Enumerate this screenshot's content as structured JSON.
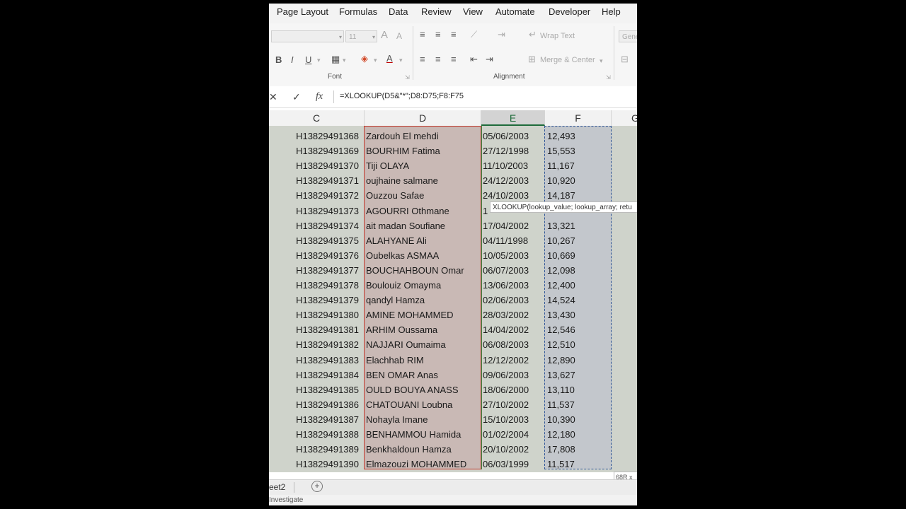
{
  "menu": {
    "tabs": [
      "Page Layout",
      "Formulas",
      "Data",
      "Review",
      "View",
      "Automate",
      "Developer",
      "Help"
    ]
  },
  "ribbon": {
    "font": {
      "font_size": "11",
      "bold": "B",
      "italic": "I",
      "underline": "U",
      "increase_font": "A",
      "decrease_font": "A",
      "group_label": "Font"
    },
    "alignment": {
      "wrap_text": "Wrap Text",
      "merge_center": "Merge & Center",
      "group_label": "Alignment"
    },
    "number": {
      "format_partial": "Gene"
    }
  },
  "formula_bar": {
    "cancel": "✕",
    "enter": "✓",
    "fx": "fx",
    "formula": "=XLOOKUP(D5&\"*\";D8:D75;F8:F75"
  },
  "columns": [
    {
      "label": "C",
      "selected": false
    },
    {
      "label": "D",
      "selected": false
    },
    {
      "label": "E",
      "selected": true
    },
    {
      "label": "F",
      "selected": false
    },
    {
      "label": "G",
      "selected": false
    }
  ],
  "rows": [
    {
      "id": "H13829491368",
      "name": "Zardouh  El mehdi",
      "date": "05/06/2003",
      "amount": "12,493"
    },
    {
      "id": "H13829491369",
      "name": "BOURHIM Fatima",
      "date": "27/12/1998",
      "amount": "15,553"
    },
    {
      "id": "H13829491370",
      "name": "Tiji OLAYA",
      "date": "11/10/2003",
      "amount": "11,167"
    },
    {
      "id": "H13829491371",
      "name": "oujhaine salmane",
      "date": "24/12/2003",
      "amount": "10,920"
    },
    {
      "id": "H13829491372",
      "name": "Ouzzou  Safae",
      "date": "24/10/2003",
      "amount": "14,187"
    },
    {
      "id": "H13829491373",
      "name": "AGOURRI Othmane",
      "date": "1",
      "amount": ""
    },
    {
      "id": "H13829491374",
      "name": "ait madan Soufiane",
      "date": "17/04/2002",
      "amount": "13,321"
    },
    {
      "id": "H13829491375",
      "name": "ALAHYANE Ali",
      "date": "04/11/1998",
      "amount": "10,267"
    },
    {
      "id": "H13829491376",
      "name": "Oubelkas ASMAA",
      "date": "10/05/2003",
      "amount": "10,669"
    },
    {
      "id": "H13829491377",
      "name": "BOUCHAHBOUN Omar",
      "date": "06/07/2003",
      "amount": "12,098"
    },
    {
      "id": "H13829491378",
      "name": "Boulouiz Omayma",
      "date": "13/06/2003",
      "amount": "12,400"
    },
    {
      "id": "H13829491379",
      "name": "qandyl Hamza",
      "date": "02/06/2003",
      "amount": "14,524"
    },
    {
      "id": "H13829491380",
      "name": "AMINE MOHAMMED",
      "date": "28/03/2002",
      "amount": "13,430"
    },
    {
      "id": "H13829491381",
      "name": "ARHIM Oussama",
      "date": "14/04/2002",
      "amount": "12,546"
    },
    {
      "id": "H13829491382",
      "name": "NAJJARI Oumaima",
      "date": "06/08/2003",
      "amount": "12,510"
    },
    {
      "id": "H13829491383",
      "name": "Elachhab RIM",
      "date": "12/12/2002",
      "amount": "12,890"
    },
    {
      "id": "H13829491384",
      "name": "BEN OMAR Anas",
      "date": "09/06/2003",
      "amount": "13,627"
    },
    {
      "id": "H13829491385",
      "name": "OULD BOUYA ANASS",
      "date": "18/06/2000",
      "amount": "13,110"
    },
    {
      "id": "H13829491386",
      "name": "CHATOUANI Loubna",
      "date": "27/10/2002",
      "amount": "11,537"
    },
    {
      "id": "H13829491387",
      "name": "Nohayla Imane",
      "date": "15/10/2003",
      "amount": "10,390"
    },
    {
      "id": "H13829491388",
      "name": "BENHAMMOU Hamida",
      "date": "01/02/2004",
      "amount": "12,180"
    },
    {
      "id": "H13829491389",
      "name": "Benkhaldoun Hamza",
      "date": "20/10/2002",
      "amount": "17,808"
    },
    {
      "id": "H13829491390",
      "name": "Elmazouzi  MOHAMMED",
      "date": "06/03/1999",
      "amount": "11,517"
    }
  ],
  "tooltip": {
    "text": "XLOOKUP(lookup_value; lookup_array; retu"
  },
  "selection_size": "68R x",
  "sheet_tab": "eet2",
  "add_sheet": "+",
  "status": "Investigate",
  "colors": {
    "range_d_fill": "#c9b9b5",
    "range_d_border": "#c0392b",
    "range_f_fill": "#c3c7cc",
    "range_f_border": "#2f5597",
    "grid_bg": "#cfd3cb",
    "selected_header": "#1e6b3a"
  }
}
